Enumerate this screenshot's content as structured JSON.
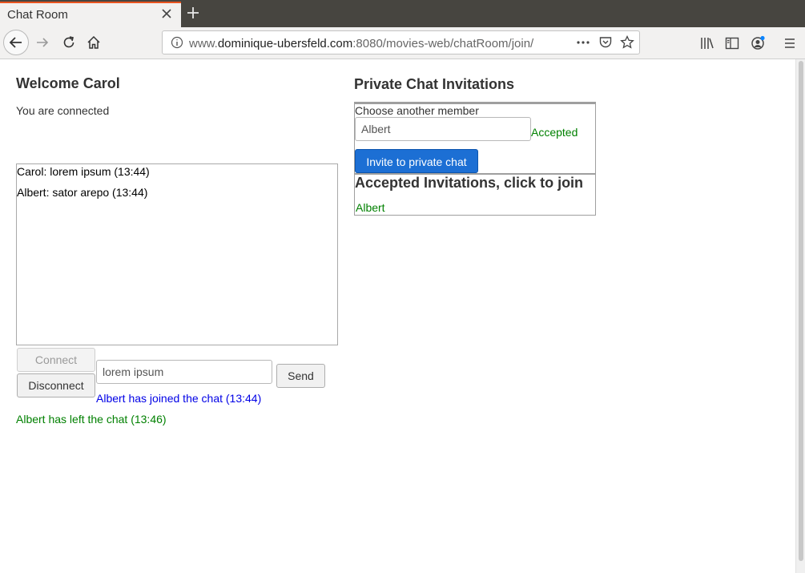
{
  "browser": {
    "tab_title": "Chat Room",
    "url_prefix": "www.",
    "url_host": "dominique-ubersfeld.com",
    "url_rest": ":8080/movies-web/chatRoom/join/",
    "icons": [
      "back-icon",
      "forward-icon",
      "reload-icon",
      "home-icon",
      "info-icon",
      "more-icon",
      "pocket-icon",
      "bookmark-star-icon",
      "library-icon",
      "sidebar-icon",
      "account-icon",
      "menu-icon",
      "close-icon",
      "plus-icon"
    ]
  },
  "main": {
    "welcome": "Welcome Carol",
    "status": "You are connected",
    "messages": [
      "Carol: lorem ipsum (13:44)",
      "Albert: sator arepo (13:44)"
    ],
    "connect_label": "Connect",
    "disconnect_label": "Disconnect",
    "message_value": "lorem ipsum",
    "send_label": "Send",
    "joined_notice": "Albert has joined the chat (13:44)",
    "left_notice": "Albert has left the chat (13:46)"
  },
  "private": {
    "heading": "Private Chat Invitations",
    "choose_label": "Choose another member",
    "member_value": "Albert",
    "accepted_status": "Accepted",
    "invite_label": "Invite to private chat",
    "accepted_heading": "Accepted Invitations, click to join",
    "accepted_members": [
      "Albert"
    ]
  },
  "colors": {
    "accent_tab": "#e95420",
    "link_green": "#008000",
    "notice_blue": "#0000e6",
    "primary_button": "#1c6fd4"
  }
}
